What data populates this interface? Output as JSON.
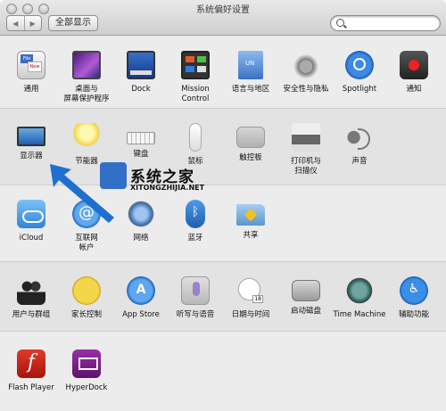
{
  "window": {
    "title": "系统偏好设置"
  },
  "toolbar": {
    "back": "◀",
    "forward": "▶",
    "show_all": "全部显示",
    "search_placeholder": ""
  },
  "rows": [
    [
      {
        "id": "general",
        "label": "通用",
        "icon": "general-icon"
      },
      {
        "id": "desktop",
        "label": "桌面与\n屏幕保护程序",
        "icon": "desktop-icon"
      },
      {
        "id": "dock",
        "label": "Dock",
        "icon": "dock-icon"
      },
      {
        "id": "mission",
        "label": "Mission\nControl",
        "icon": "mission-control-icon"
      },
      {
        "id": "lang",
        "label": "语言与地区",
        "icon": "language-region-icon"
      },
      {
        "id": "security",
        "label": "安全性与隐私",
        "icon": "security-privacy-icon"
      },
      {
        "id": "spotlight",
        "label": "Spotlight",
        "icon": "spotlight-icon"
      },
      {
        "id": "notify",
        "label": "通知",
        "icon": "notifications-icon"
      }
    ],
    [
      {
        "id": "display",
        "label": "显示器",
        "icon": "display-icon"
      },
      {
        "id": "energy",
        "label": "节能器",
        "icon": "energy-saver-icon"
      },
      {
        "id": "keyboard",
        "label": "键盘",
        "icon": "keyboard-icon"
      },
      {
        "id": "mouse",
        "label": "鼠标",
        "icon": "mouse-icon"
      },
      {
        "id": "trackpad",
        "label": "触控板",
        "icon": "trackpad-icon"
      },
      {
        "id": "printer",
        "label": "打印机与\n扫描仪",
        "icon": "printer-icon"
      },
      {
        "id": "sound",
        "label": "声音",
        "icon": "sound-icon"
      }
    ],
    [
      {
        "id": "icloud",
        "label": "iCloud",
        "icon": "icloud-icon"
      },
      {
        "id": "internet",
        "label": "互联网\n帐户",
        "icon": "internet-accounts-icon"
      },
      {
        "id": "network",
        "label": "网络",
        "icon": "network-icon"
      },
      {
        "id": "bluetooth",
        "label": "蓝牙",
        "icon": "bluetooth-icon"
      },
      {
        "id": "sharing",
        "label": "共享",
        "icon": "sharing-icon"
      }
    ],
    [
      {
        "id": "users",
        "label": "用户与群组",
        "icon": "users-groups-icon"
      },
      {
        "id": "parental",
        "label": "家长控制",
        "icon": "parental-controls-icon"
      },
      {
        "id": "appstore",
        "label": "App Store",
        "icon": "app-store-icon"
      },
      {
        "id": "dictation",
        "label": "听写与语音",
        "icon": "dictation-icon"
      },
      {
        "id": "datetime",
        "label": "日期与时间",
        "icon": "date-time-icon"
      },
      {
        "id": "startup",
        "label": "启动磁盘",
        "icon": "startup-disk-icon"
      },
      {
        "id": "timemachine",
        "label": "Time Machine",
        "icon": "time-machine-icon"
      },
      {
        "id": "access",
        "label": "辅助功能",
        "icon": "accessibility-icon"
      }
    ],
    [
      {
        "id": "flash",
        "label": "Flash Player",
        "icon": "flash-player-icon"
      },
      {
        "id": "hyperdock",
        "label": "HyperDock",
        "icon": "hyperdock-icon"
      }
    ]
  ],
  "watermark": {
    "title": "系统之家",
    "url": "XITONGZHIJIA.NET"
  },
  "colors": {
    "arrow": "#1f6fd1",
    "accent": "#3d8ae3"
  }
}
